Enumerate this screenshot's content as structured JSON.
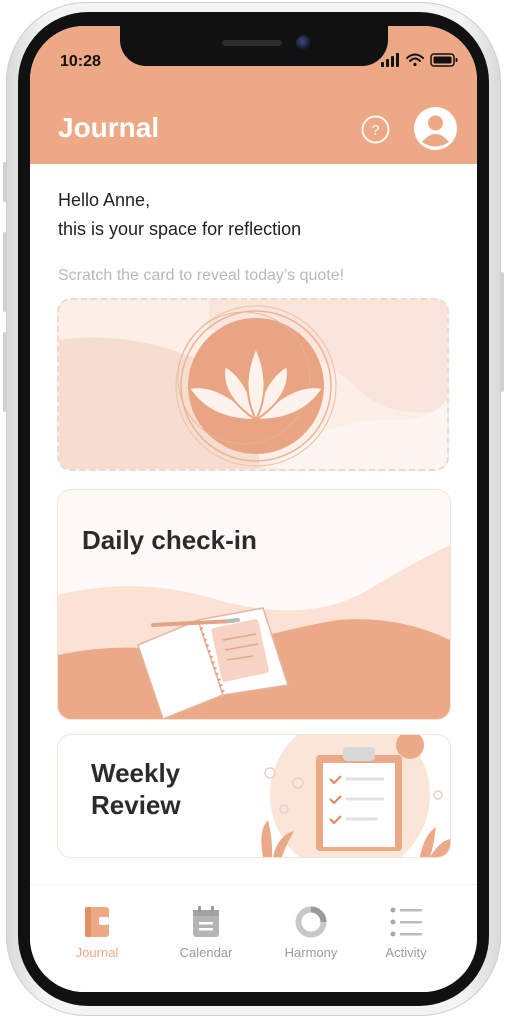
{
  "status_bar": {
    "time": "10:28"
  },
  "header": {
    "title": "Journal",
    "help_icon": "help-circle-icon",
    "avatar_icon": "user-avatar-icon"
  },
  "greeting": {
    "line1": "Hello Anne,",
    "line2": "this is your space for reflection"
  },
  "scratch": {
    "hint": "Scratch the card to reveal today’s quote!",
    "icon": "lotus-icon"
  },
  "cards": {
    "checkin_title": "Daily check-in",
    "weekly_title_line1": "Weekly",
    "weekly_title_line2": "Review"
  },
  "tabs": [
    {
      "label": "Journal",
      "icon": "journal-icon",
      "active": true
    },
    {
      "label": "Calendar",
      "icon": "calendar-icon",
      "active": false
    },
    {
      "label": "Harmony",
      "icon": "harmony-ring-icon",
      "active": false
    },
    {
      "label": "Activity",
      "icon": "activity-list-icon",
      "active": false
    }
  ],
  "colors": {
    "accent": "#eda986",
    "accent_dark": "#e09a74",
    "text": "#222222",
    "muted": "#b9b9b9"
  }
}
